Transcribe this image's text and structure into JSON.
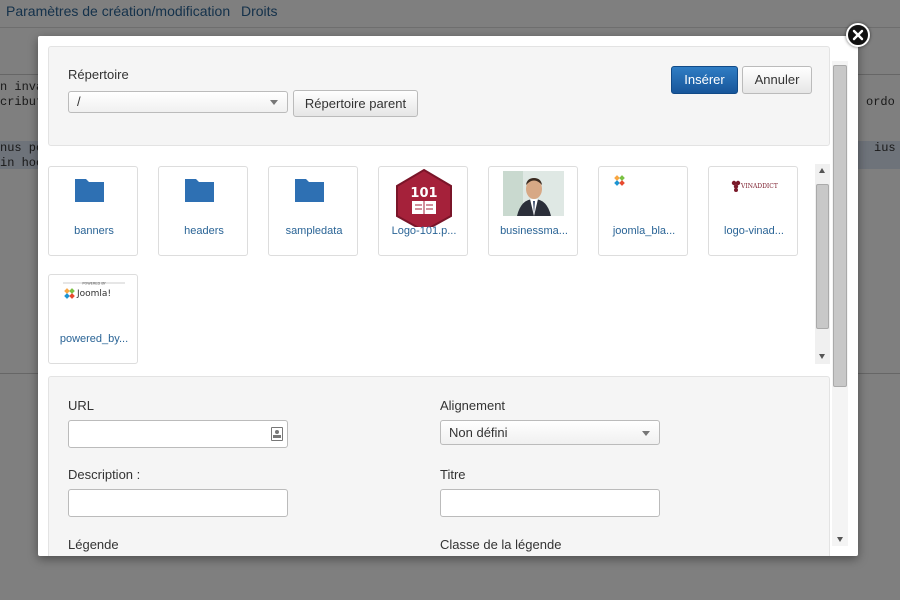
{
  "background": {
    "tabs": [
      "Paramètres de création/modification",
      "Droits"
    ],
    "code_lines": [
      "n inva",
      "cribut",
      "nus po",
      "in hoc",
      "ordo",
      "ius"
    ]
  },
  "modal": {
    "close_icon": "close-icon",
    "directory": {
      "label": "Répertoire",
      "selected": "/",
      "parent_button": "Répertoire parent"
    },
    "actions": {
      "insert": "Insérer",
      "cancel": "Annuler"
    },
    "files": [
      {
        "name": "banners",
        "type": "folder",
        "icon": "folder-icon"
      },
      {
        "name": "headers",
        "type": "folder",
        "icon": "folder-icon"
      },
      {
        "name": "sampledata",
        "type": "folder",
        "icon": "folder-icon"
      },
      {
        "name": "Logo-101.p...",
        "type": "image",
        "icon": "logo-101-icon"
      },
      {
        "name": "businessma...",
        "type": "image",
        "icon": "businessman-thumbnail"
      },
      {
        "name": "joomla_bla...",
        "type": "image",
        "icon": "joomla-logo-icon"
      },
      {
        "name": "logo-vinad...",
        "type": "image",
        "icon": "vinaddict-logo-icon"
      },
      {
        "name": "powered_by...",
        "type": "image",
        "icon": "powered-by-joomla-logo"
      }
    ],
    "thumb_text": {
      "logo101": "101",
      "vinaddict": "VINADDICT",
      "powered_by": "POWERED BY",
      "joomla": "Joomla!"
    },
    "form": {
      "url_label": "URL",
      "url_value": "",
      "alignment_label": "Alignement",
      "alignment_selected": "Non défini",
      "description_label": "Description :",
      "description_value": "",
      "title_label": "Titre",
      "title_value": "",
      "caption_label": "Légende",
      "caption_class_label": "Classe de la légende"
    }
  },
  "colors": {
    "link": "#2a6496",
    "primary": "#1f63a8",
    "folder": "#2e70b3",
    "overlay": "rgba(0,0,0,0.5)"
  }
}
